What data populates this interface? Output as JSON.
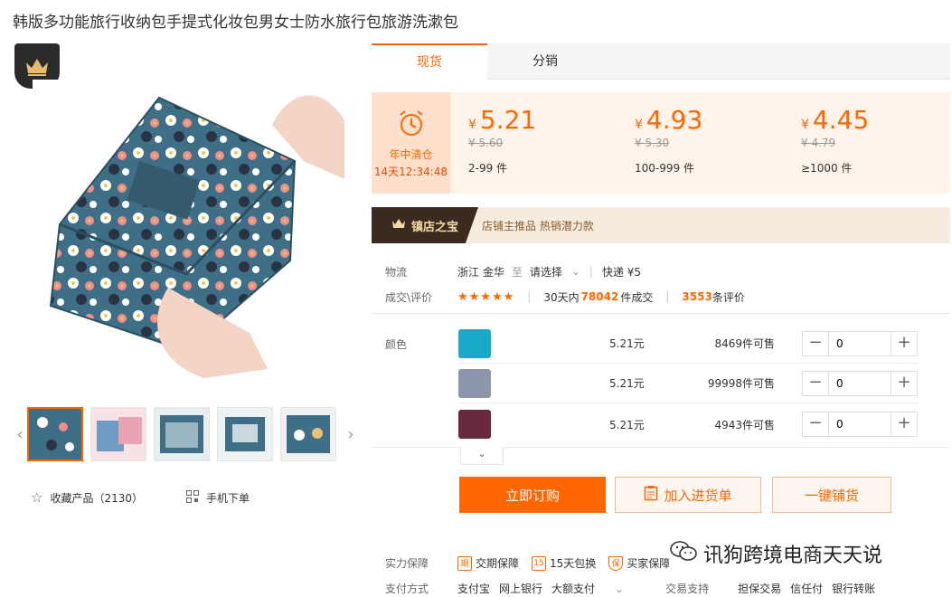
{
  "product": {
    "title": "韩版多功能旅行收纳包手提式化妆包男女士防水旅行包旅游洗漱包"
  },
  "gallery": {
    "actions": {
      "favorite_label": "收藏产品（2130）",
      "mobile_label": "手机下单"
    }
  },
  "tabs": [
    {
      "label": "现货",
      "active": true
    },
    {
      "label": "分销",
      "active": false
    }
  ],
  "promo": {
    "name": "年中清仓",
    "countdown": "14天12:34:48"
  },
  "price_tiers": [
    {
      "currency": "¥",
      "price": "5.21",
      "old_price": "¥ 5.60",
      "range": "2-99 件"
    },
    {
      "currency": "¥",
      "price": "4.93",
      "old_price": "¥ 5.30",
      "range": "100-999 件"
    },
    {
      "currency": "¥",
      "price": "4.45",
      "old_price": "¥ 4.79",
      "range": "≥1000 件"
    }
  ],
  "shop_bar": {
    "badge": "镇店之宝",
    "text": "店铺主推品  热销潜力款"
  },
  "logistics": {
    "label": "物流",
    "origin": "浙江 金华",
    "to": "至",
    "select": "请选择",
    "express": "快递 ¥5"
  },
  "deals": {
    "label": "成交\\评价",
    "stars": "★★★★★",
    "prefix": "30天内",
    "count": "78042",
    "suffix": "件成交",
    "reviews": "3553",
    "reviews_suffix": "条评价"
  },
  "colors_label": "颜色",
  "skus": [
    {
      "color": "#1aa9c9",
      "price": "5.21元",
      "stock": "8469件可售",
      "qty": "0"
    },
    {
      "color": "#8e96ad",
      "price": "5.21元",
      "stock": "99998件可售",
      "qty": "0"
    },
    {
      "color": "#6a2a3e",
      "price": "5.21元",
      "stock": "4943件可售",
      "qty": "0"
    }
  ],
  "buttons": {
    "buy": "立即订购",
    "cart": "加入进货单",
    "distribute": "一键铺货"
  },
  "guarantee": {
    "label": "实力保障",
    "items": [
      "交期保障",
      "15天包换",
      "买家保障"
    ]
  },
  "payment": {
    "label": "支付方式",
    "methods": [
      "支付宝",
      "网上银行",
      "大额支付"
    ],
    "trade_label": "交易支持",
    "trade_methods": [
      "担保交易",
      "信任付",
      "银行转账"
    ]
  },
  "watermark": "讯狗跨境电商天天说",
  "accent_color": "#ff6600"
}
